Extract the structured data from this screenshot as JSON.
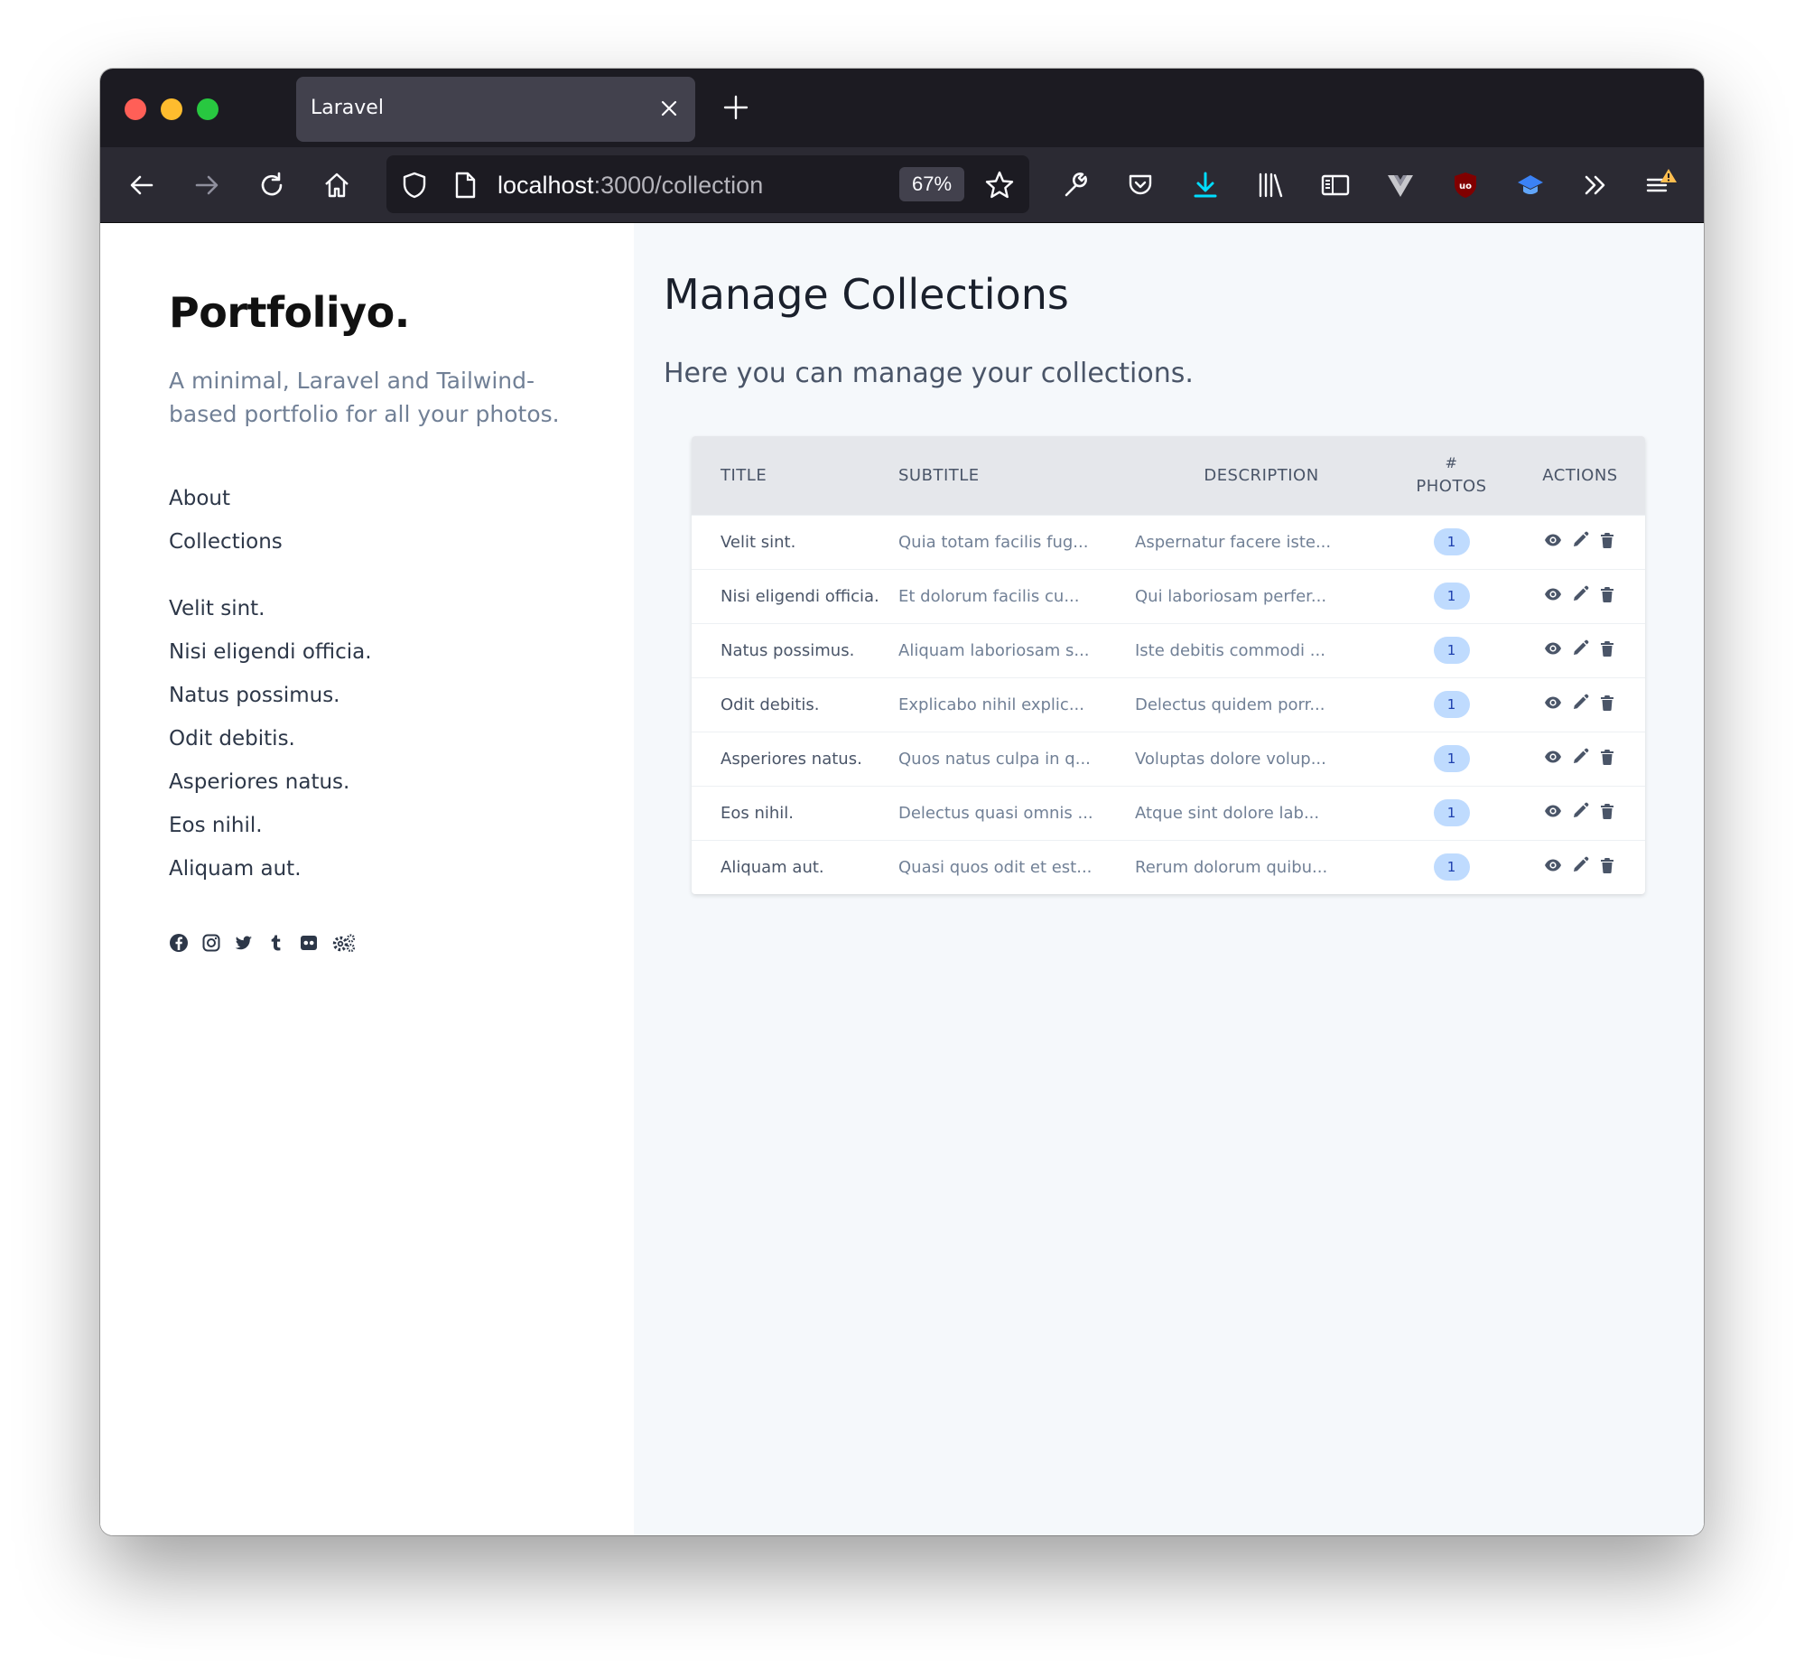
{
  "browser": {
    "tab_title": "Laravel",
    "url_host": "localhost",
    "url_path": ":3000/collection",
    "zoom": "67%"
  },
  "sidebar": {
    "brand": "Portfoliyo.",
    "tagline": "A minimal, Laravel and Tailwind-based portfolio for all your photos.",
    "nav": [
      {
        "label": "About"
      },
      {
        "label": "Collections"
      }
    ],
    "collections": [
      {
        "label": "Velit sint."
      },
      {
        "label": "Nisi eligendi officia."
      },
      {
        "label": "Natus possimus."
      },
      {
        "label": "Odit debitis."
      },
      {
        "label": "Asperiores natus."
      },
      {
        "label": "Eos nihil."
      },
      {
        "label": "Aliquam aut."
      }
    ],
    "socials": [
      "facebook-icon",
      "instagram-icon",
      "twitter-icon",
      "tumblr-icon",
      "flickr-icon",
      "settings-cogs-icon"
    ]
  },
  "main": {
    "title": "Manage Collections",
    "subtitle": "Here you can manage your collections.",
    "table": {
      "headers": {
        "title": "TITLE",
        "subtitle": "SUBTITLE",
        "description": "DESCRIPTION",
        "photos_hash": "#",
        "photos": "PHOTOS",
        "actions": "ACTIONS"
      },
      "rows": [
        {
          "title": "Velit sint.",
          "subtitle": "Quia totam facilis fug...",
          "description": "Aspernatur facere iste...",
          "photos": "1"
        },
        {
          "title": "Nisi eligendi officia.",
          "subtitle": "Et dolorum facilis cu...",
          "description": "Qui laboriosam perfer...",
          "photos": "1"
        },
        {
          "title": "Natus possimus.",
          "subtitle": "Aliquam laboriosam s...",
          "description": "Iste debitis commodi ...",
          "photos": "1"
        },
        {
          "title": "Odit debitis.",
          "subtitle": "Explicabo nihil explic...",
          "description": "Delectus quidem porr...",
          "photos": "1"
        },
        {
          "title": "Asperiores natus.",
          "subtitle": "Quos natus culpa in q...",
          "description": "Voluptas dolore volup...",
          "photos": "1"
        },
        {
          "title": "Eos nihil.",
          "subtitle": "Delectus quasi omnis ...",
          "description": "Atque sint dolore lab...",
          "photos": "1"
        },
        {
          "title": "Aliquam aut.",
          "subtitle": "Quasi quos odit et est...",
          "description": "Rerum dolorum quibu...",
          "photos": "1"
        }
      ]
    }
  },
  "colors": {
    "titlebar": "#1c1b22",
    "toolbar": "#2b2a33",
    "download_accent": "#00ddff",
    "badge_bg": "#bfdbfe",
    "badge_text": "#1e40af",
    "main_bg": "#f5f8fb"
  }
}
